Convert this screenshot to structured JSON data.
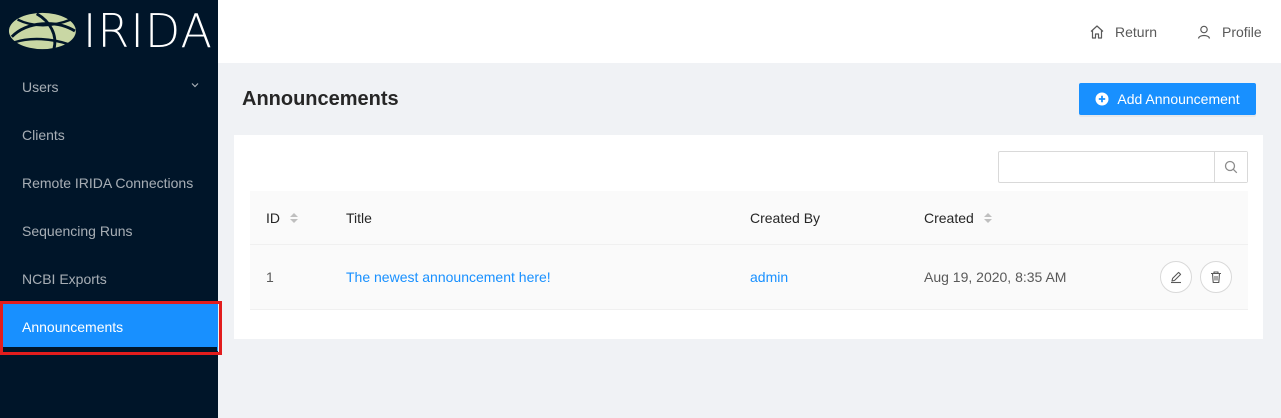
{
  "app": {
    "logo_text": "IRIDA"
  },
  "sidebar": {
    "items": [
      {
        "label": "Users"
      },
      {
        "label": "Clients"
      },
      {
        "label": "Remote IRIDA Connections"
      },
      {
        "label": "Sequencing Runs"
      },
      {
        "label": "NCBI Exports"
      },
      {
        "label": "Announcements"
      }
    ],
    "active_index": 5
  },
  "header": {
    "return_label": "Return",
    "profile_label": "Profile"
  },
  "page": {
    "title": "Announcements",
    "add_button_label": "Add Announcement"
  },
  "search": {
    "value": "",
    "placeholder": ""
  },
  "table": {
    "columns": [
      "ID",
      "Title",
      "Created By",
      "Created"
    ],
    "rows": [
      {
        "id": "1",
        "title": "The newest announcement here!",
        "created_by": "admin",
        "created": "Aug 19, 2020, 8:35 AM"
      }
    ]
  },
  "colors": {
    "sidebar_bg": "#001529",
    "accent": "#1890ff",
    "highlight_border": "#e21d1d"
  }
}
